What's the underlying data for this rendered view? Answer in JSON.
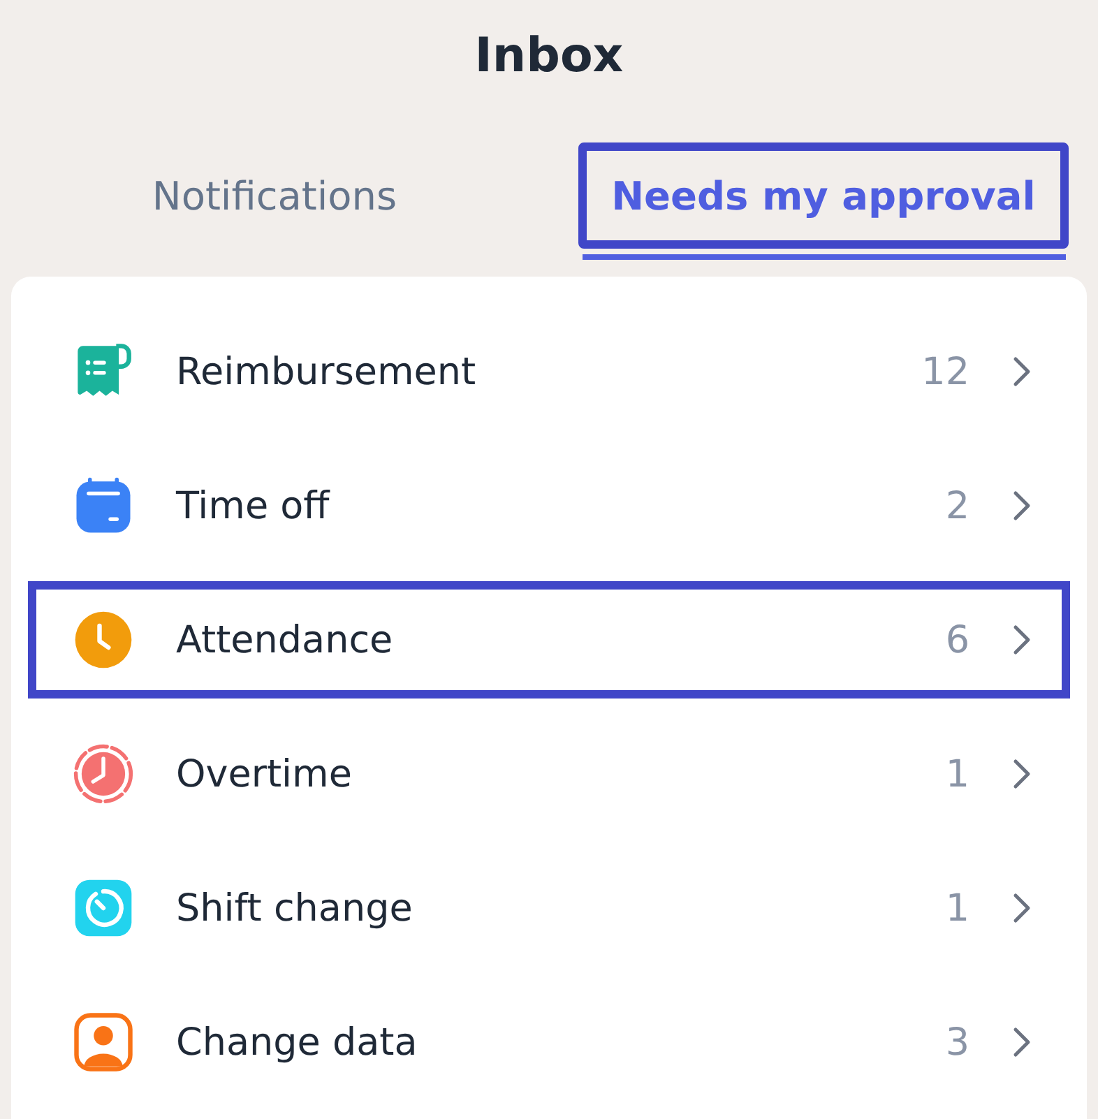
{
  "title": "Inbox",
  "tabs": [
    {
      "label": "Notifications",
      "selected": false,
      "highlighted": false
    },
    {
      "label": "Needs my approval",
      "selected": true,
      "highlighted": true
    }
  ],
  "items": [
    {
      "kind": "receipt",
      "label": "Reimbursement",
      "count": "12",
      "color": "#1bb39b",
      "highlighted": false
    },
    {
      "kind": "calendar",
      "label": "Time off",
      "count": "2",
      "color": "#3b82f6",
      "highlighted": false
    },
    {
      "kind": "clock",
      "label": "Attendance",
      "count": "6",
      "color": "#f29c0c",
      "highlighted": true
    },
    {
      "kind": "overtime",
      "label": "Overtime",
      "count": "1",
      "color": "#f47171",
      "highlighted": false
    },
    {
      "kind": "timer",
      "label": "Shift change",
      "count": "1",
      "color": "#22d3ee",
      "highlighted": false
    },
    {
      "kind": "person",
      "label": "Change data",
      "count": "3",
      "color": "#f97316",
      "highlighted": false
    }
  ]
}
